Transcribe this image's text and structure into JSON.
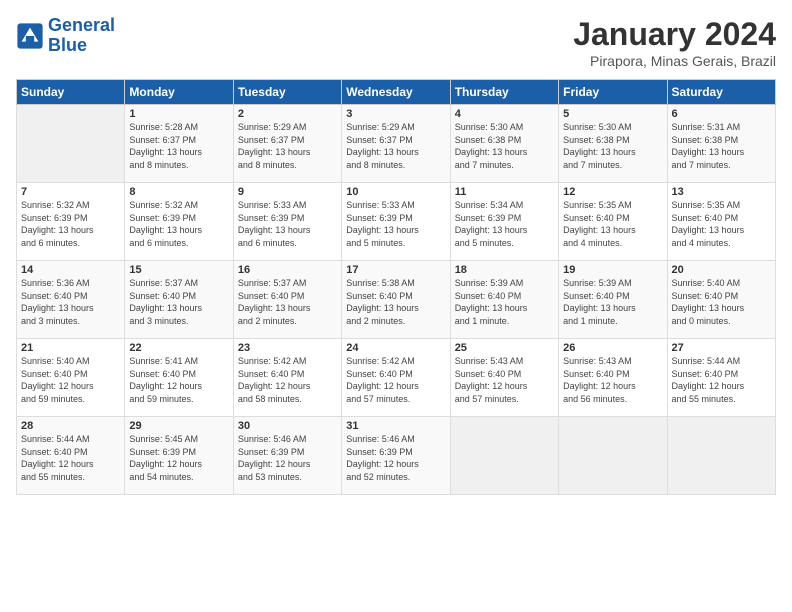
{
  "logo": {
    "line1": "General",
    "line2": "Blue"
  },
  "title": "January 2024",
  "subtitle": "Pirapora, Minas Gerais, Brazil",
  "days_header": [
    "Sunday",
    "Monday",
    "Tuesday",
    "Wednesday",
    "Thursday",
    "Friday",
    "Saturday"
  ],
  "weeks": [
    [
      {
        "day": "",
        "info": ""
      },
      {
        "day": "1",
        "info": "Sunrise: 5:28 AM\nSunset: 6:37 PM\nDaylight: 13 hours\nand 8 minutes."
      },
      {
        "day": "2",
        "info": "Sunrise: 5:29 AM\nSunset: 6:37 PM\nDaylight: 13 hours\nand 8 minutes."
      },
      {
        "day": "3",
        "info": "Sunrise: 5:29 AM\nSunset: 6:37 PM\nDaylight: 13 hours\nand 8 minutes."
      },
      {
        "day": "4",
        "info": "Sunrise: 5:30 AM\nSunset: 6:38 PM\nDaylight: 13 hours\nand 7 minutes."
      },
      {
        "day": "5",
        "info": "Sunrise: 5:30 AM\nSunset: 6:38 PM\nDaylight: 13 hours\nand 7 minutes."
      },
      {
        "day": "6",
        "info": "Sunrise: 5:31 AM\nSunset: 6:38 PM\nDaylight: 13 hours\nand 7 minutes."
      }
    ],
    [
      {
        "day": "7",
        "info": "Sunrise: 5:32 AM\nSunset: 6:39 PM\nDaylight: 13 hours\nand 6 minutes."
      },
      {
        "day": "8",
        "info": "Sunrise: 5:32 AM\nSunset: 6:39 PM\nDaylight: 13 hours\nand 6 minutes."
      },
      {
        "day": "9",
        "info": "Sunrise: 5:33 AM\nSunset: 6:39 PM\nDaylight: 13 hours\nand 6 minutes."
      },
      {
        "day": "10",
        "info": "Sunrise: 5:33 AM\nSunset: 6:39 PM\nDaylight: 13 hours\nand 5 minutes."
      },
      {
        "day": "11",
        "info": "Sunrise: 5:34 AM\nSunset: 6:39 PM\nDaylight: 13 hours\nand 5 minutes."
      },
      {
        "day": "12",
        "info": "Sunrise: 5:35 AM\nSunset: 6:40 PM\nDaylight: 13 hours\nand 4 minutes."
      },
      {
        "day": "13",
        "info": "Sunrise: 5:35 AM\nSunset: 6:40 PM\nDaylight: 13 hours\nand 4 minutes."
      }
    ],
    [
      {
        "day": "14",
        "info": "Sunrise: 5:36 AM\nSunset: 6:40 PM\nDaylight: 13 hours\nand 3 minutes."
      },
      {
        "day": "15",
        "info": "Sunrise: 5:37 AM\nSunset: 6:40 PM\nDaylight: 13 hours\nand 3 minutes."
      },
      {
        "day": "16",
        "info": "Sunrise: 5:37 AM\nSunset: 6:40 PM\nDaylight: 13 hours\nand 2 minutes."
      },
      {
        "day": "17",
        "info": "Sunrise: 5:38 AM\nSunset: 6:40 PM\nDaylight: 13 hours\nand 2 minutes."
      },
      {
        "day": "18",
        "info": "Sunrise: 5:39 AM\nSunset: 6:40 PM\nDaylight: 13 hours\nand 1 minute."
      },
      {
        "day": "19",
        "info": "Sunrise: 5:39 AM\nSunset: 6:40 PM\nDaylight: 13 hours\nand 1 minute."
      },
      {
        "day": "20",
        "info": "Sunrise: 5:40 AM\nSunset: 6:40 PM\nDaylight: 13 hours\nand 0 minutes."
      }
    ],
    [
      {
        "day": "21",
        "info": "Sunrise: 5:40 AM\nSunset: 6:40 PM\nDaylight: 12 hours\nand 59 minutes."
      },
      {
        "day": "22",
        "info": "Sunrise: 5:41 AM\nSunset: 6:40 PM\nDaylight: 12 hours\nand 59 minutes."
      },
      {
        "day": "23",
        "info": "Sunrise: 5:42 AM\nSunset: 6:40 PM\nDaylight: 12 hours\nand 58 minutes."
      },
      {
        "day": "24",
        "info": "Sunrise: 5:42 AM\nSunset: 6:40 PM\nDaylight: 12 hours\nand 57 minutes."
      },
      {
        "day": "25",
        "info": "Sunrise: 5:43 AM\nSunset: 6:40 PM\nDaylight: 12 hours\nand 57 minutes."
      },
      {
        "day": "26",
        "info": "Sunrise: 5:43 AM\nSunset: 6:40 PM\nDaylight: 12 hours\nand 56 minutes."
      },
      {
        "day": "27",
        "info": "Sunrise: 5:44 AM\nSunset: 6:40 PM\nDaylight: 12 hours\nand 55 minutes."
      }
    ],
    [
      {
        "day": "28",
        "info": "Sunrise: 5:44 AM\nSunset: 6:40 PM\nDaylight: 12 hours\nand 55 minutes."
      },
      {
        "day": "29",
        "info": "Sunrise: 5:45 AM\nSunset: 6:39 PM\nDaylight: 12 hours\nand 54 minutes."
      },
      {
        "day": "30",
        "info": "Sunrise: 5:46 AM\nSunset: 6:39 PM\nDaylight: 12 hours\nand 53 minutes."
      },
      {
        "day": "31",
        "info": "Sunrise: 5:46 AM\nSunset: 6:39 PM\nDaylight: 12 hours\nand 52 minutes."
      },
      {
        "day": "",
        "info": ""
      },
      {
        "day": "",
        "info": ""
      },
      {
        "day": "",
        "info": ""
      }
    ]
  ]
}
